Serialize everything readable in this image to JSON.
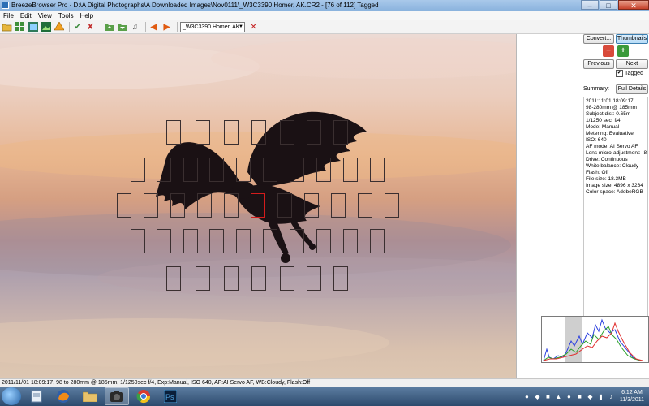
{
  "window": {
    "title": "BreezeBrowser Pro - D:\\A Digital Photographs\\A Downloaded Images\\Nov0111\\_W3C3390  Homer, AK.CR2 - [76 of 112] Tagged",
    "minimize": "–",
    "maximize": "□",
    "close": "✕"
  },
  "menu": [
    "File",
    "Edit",
    "View",
    "Tools",
    "Help"
  ],
  "toolbar": {
    "file_select_value": "_W3C3390  Homer, AK.",
    "icons": [
      "open-folder-icon",
      "grid-icon",
      "thumbnails-icon",
      "image-icon",
      "flash-icon",
      "check-icon",
      "untag-icon",
      "folder-up-icon",
      "folder-down-icon",
      "music-icon",
      "back-arrow-icon",
      "forward-arrow-icon",
      "delete-icon"
    ]
  },
  "panel": {
    "convert_label": "Convert...",
    "thumbnails_label": "Thumbnails",
    "previous_label": "Previous",
    "next_label": "Next",
    "tagged_label": "Tagged",
    "tagged_checked": true,
    "summary_label": "Summary:",
    "full_details_label": "Full Details",
    "exif_lines": [
      "2011:11:01 18:09:17",
      "98-280mm @ 185mm",
      "Subject dist: 0.65m",
      "1/1250 sec, f/4",
      "Mode: Manual",
      "Metering: Evaluative",
      "ISO: 640",
      "AF mode: AI Servo AF",
      "Lens micro-adjustment: -8",
      "Drive: Continuous",
      "White balance: Cloudy",
      "Flash: Off",
      "File size: 18.3MB",
      "Image size: 4896 x 3264",
      "Color space: AdobeRGB"
    ]
  },
  "statusbar": {
    "text": "2011/11/01 18:09:17, 98 to 280mm @ 185mm, 1/1250sec f/4, Exp:Manual, ISO 640, AF:AI Servo AF, WB:Cloudy, Flash:Off"
  },
  "taskbar": {
    "time": "6:12 AM",
    "date": "11/3/2011"
  },
  "colors": {
    "af_point": "#3a2f30",
    "af_selected": "#d41c1c",
    "histogram_red": "#e03030",
    "histogram_green": "#2aa02a",
    "histogram_blue": "#2a3fe0"
  }
}
